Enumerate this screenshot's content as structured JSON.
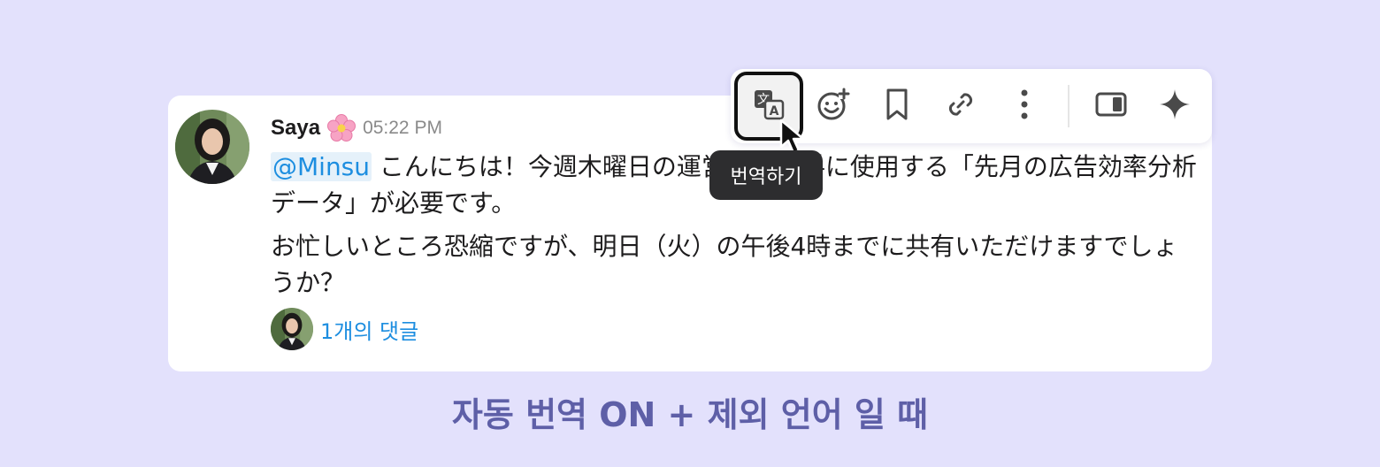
{
  "message": {
    "author": "Saya",
    "time": "05:22 PM",
    "mention": "@Minsu",
    "paragraph1": " こんにちは！今週木曜日の運営会議資料に使用する「先月の広告効率分析データ」が必要です。",
    "paragraph2": "お忙しいところ恐縮ですが、明日（火）の午後4時までに共有いただけますでしょうか？",
    "reply_count_label": "1개의 댓글"
  },
  "toolbar": {
    "buttons": [
      {
        "icon": "translate-icon",
        "active": true
      },
      {
        "icon": "add-reaction-icon"
      },
      {
        "icon": "bookmark-icon"
      },
      {
        "icon": "link-icon"
      },
      {
        "icon": "more-vertical-icon"
      },
      {
        "icon": "side-panel-icon"
      },
      {
        "icon": "ai-sparkle-icon"
      }
    ],
    "tooltip": "번역하기"
  },
  "caption": "자동 번역 ON + 제외 언어 일 때",
  "colors": {
    "background": "#e3e1fc",
    "mention": "#1d8ee0",
    "caption": "#5e5fa7",
    "tooltip_bg": "#2d2d2f"
  }
}
